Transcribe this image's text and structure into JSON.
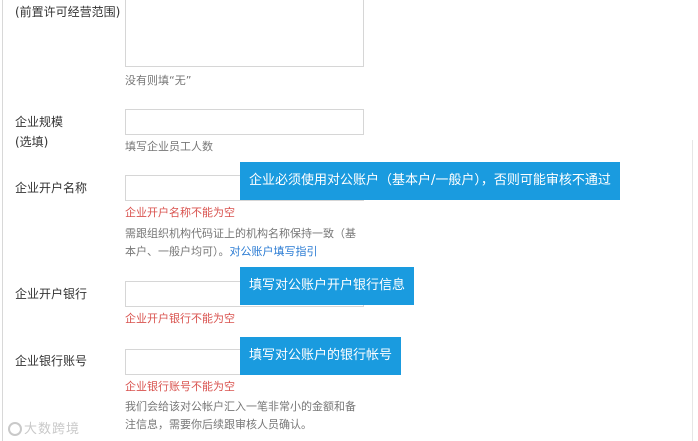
{
  "form": {
    "scope": {
      "label": "(前置许可经营范围)",
      "hint": "没有则填“无”"
    },
    "scale": {
      "label_line1": "企业规模",
      "label_line2": "(选填)",
      "hint": "填写企业员工人数"
    },
    "account_name": {
      "label": "企业开户名称",
      "error": "企业开户名称不能为空",
      "hint_line1": "需跟组织机构代码证上的机构名称保持一致（基",
      "hint_line2": "本户、一般户均可）。",
      "hint_link": "对公账户填写指引"
    },
    "bank": {
      "label": "企业开户银行",
      "error": "企业开户银行不能为空"
    },
    "account_no": {
      "label": "企业银行账号",
      "error": "企业银行账号不能为空",
      "hint_line1": "我们会给该对公帐户汇入一笔非常小的金额和备",
      "hint_line2": "注信息，需要你后续跟审核人员确认。"
    }
  },
  "callouts": {
    "account_name": "企业必须使用对公账户（基本户/一般户），否则可能审核不通过",
    "bank": "填写对公账户开户银行信息",
    "account_no": "填写对公账户的银行帐号"
  },
  "watermark": "大数跨境",
  "colors": {
    "callout_bg": "#1a9bdf",
    "error": "#d9534f",
    "link": "#2a7bd3"
  }
}
